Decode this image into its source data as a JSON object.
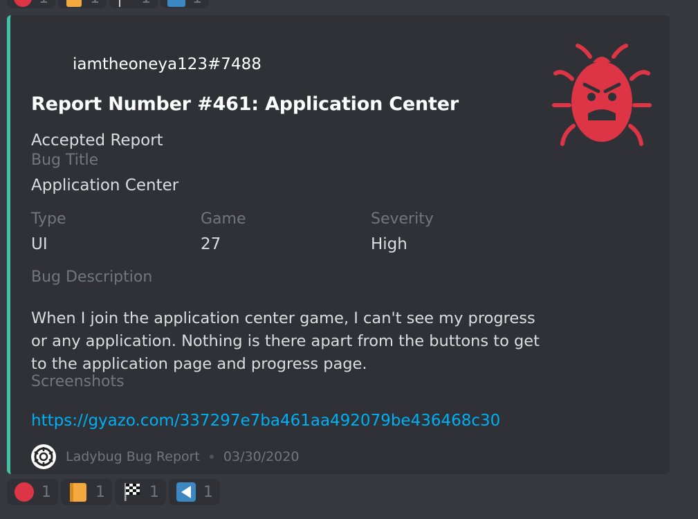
{
  "embed": {
    "author": "iamtheoneya123#7488",
    "title": "Report Number #461: Application Center",
    "description": "Accepted Report",
    "fields": {
      "bug_title_name": "Bug Title",
      "bug_title_value": "Application Center",
      "type_name": "Type",
      "type_value": "UI",
      "game_name": "Game",
      "game_value": "27",
      "severity_name": "Severity",
      "severity_value": "High",
      "bug_description_name": "Bug Description",
      "bug_description_value": "When I join the application center game, I can't see my progress or any application. Nothing is there apart from the buttons to get to the application page and progress page.",
      "screenshots_name": "Screenshots",
      "screenshots_value": "https://gyazo.com/337297e7ba461aa492079be436468c30"
    },
    "footer": {
      "text": "Ladybug Bug Report",
      "date": "03/30/2020"
    },
    "accent_color": "#43c2a6",
    "thumbnail_icon": "angry-bug-icon"
  },
  "reactions": [
    {
      "icon": "red-circle-icon",
      "count": "1"
    },
    {
      "icon": "orange-book-icon",
      "count": "1"
    },
    {
      "icon": "checkered-flag-icon",
      "count": "1"
    },
    {
      "icon": "arrow-left-icon",
      "count": "1"
    }
  ],
  "colors": {
    "background": "#36393f",
    "embed_bg": "#2f3136",
    "link": "#00aff4",
    "bug_red": "#dd3546"
  }
}
